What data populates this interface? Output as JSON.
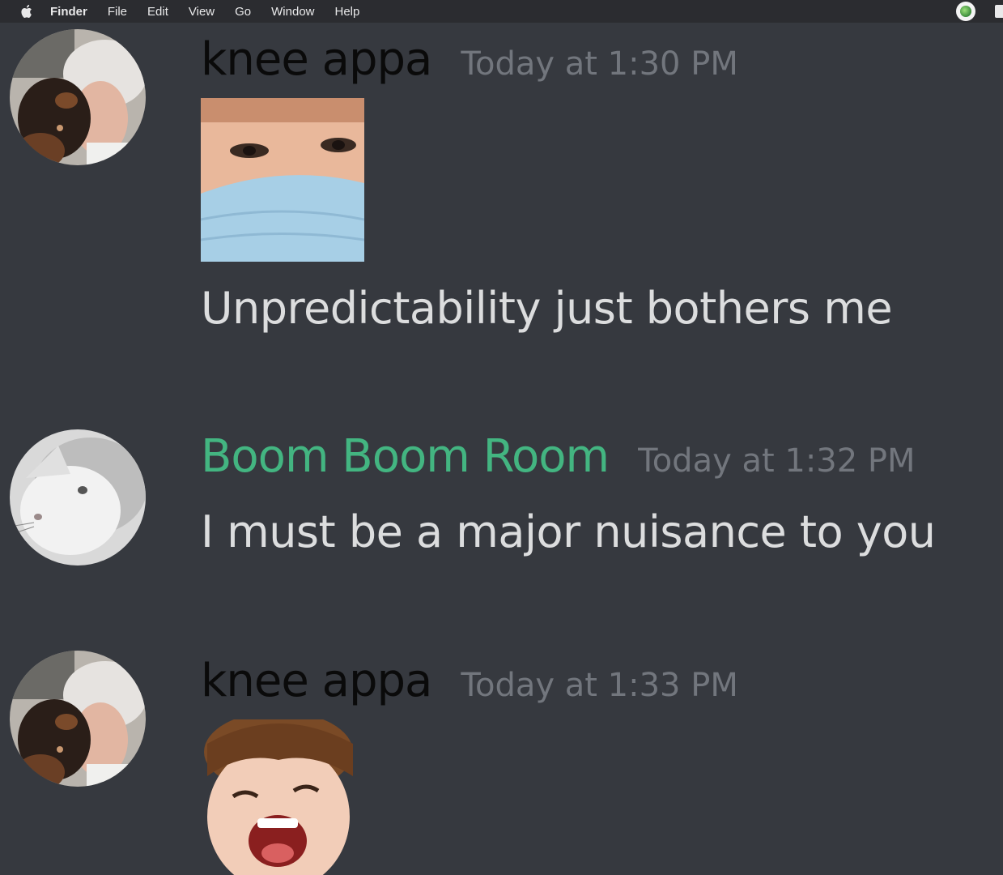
{
  "menubar": {
    "apple_icon": "apple-icon",
    "items": [
      "Finder",
      "File",
      "Edit",
      "View",
      "Go",
      "Window",
      "Help"
    ],
    "status_icons": [
      "app-status-icon",
      "notification-icon"
    ]
  },
  "messages": [
    {
      "username": "knee appa",
      "username_color": "#0a0a0a",
      "timestamp": "Today at 1:30 PM",
      "avatar": "avatar-person-kissing-dog",
      "attachment": "image-child-with-face-mask",
      "text": "Unpredictability just bothers me"
    },
    {
      "username": "Boom Boom Room",
      "username_color": "#43b581",
      "timestamp": "Today at 1:32 PM",
      "avatar": "avatar-white-cat",
      "text": "I must be a major nuisance to you"
    },
    {
      "username": "knee appa",
      "username_color": "#0a0a0a",
      "timestamp": "Today at 1:33 PM",
      "avatar": "avatar-person-kissing-dog",
      "attachment": "image-laughing-man"
    }
  ]
}
